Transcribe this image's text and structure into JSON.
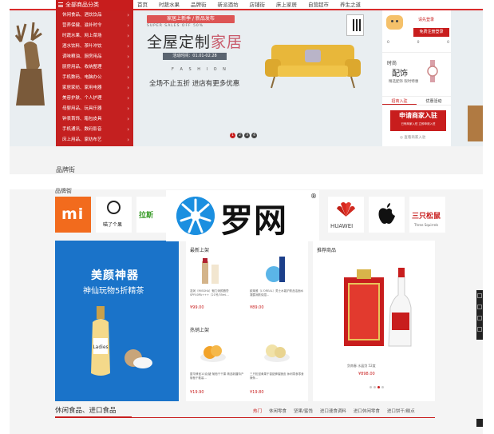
{
  "banner": {
    "catalog_label": "全部商品分类",
    "nav": [
      "首页",
      "时蔬水果",
      "品牌街",
      "新派酒坊",
      "店铺街",
      "床上家居",
      "自营超市",
      "养生之道"
    ],
    "categories": [
      "休闲食品、酒饮饮品",
      "营养保健、滋补时令",
      "时蔬水果、网上菜场",
      "酒水饮料、茶叶冲饮",
      "调味粮油、厨房用品",
      "厨房用品、收纳整理",
      "手机数码、电脑办公",
      "家居家纺、家用电器",
      "美容护肤、个人护理",
      "母婴用品、玩具乐器",
      "钟表首饰、箱包皮具",
      "手机通讯、数码影音",
      "床上用品、家纺布艺"
    ],
    "hero": {
      "badge": "家居上新季 / 新品发布",
      "sub": "SUPER SALES OFF 50%",
      "title_main": "全屋定制",
      "title_accent": "家居",
      "date": "活动时间：01.01-02.28",
      "fashion": "F A S H I O N",
      "promo": "全场不止五折  进店有更多优惠"
    },
    "slider_dots": [
      "1",
      "2",
      "3",
      "4"
    ],
    "user_panel": {
      "greeting": "请先登录",
      "login_button": "免费注册登录",
      "stats": [
        "0",
        "0",
        "0"
      ],
      "ad_line1": "时尚",
      "ad_line2": "配饰",
      "ad_line3": "精选配饰 限时特惠",
      "tabs": [
        "招商入驻",
        "优惠活动"
      ],
      "merchant_title": "申请商家入驻",
      "merchant_sub": "已有商家入驻 立即申请入驻",
      "bottom_link": "◎ 查看商家入驻"
    },
    "brand_street": "品牌街"
  },
  "lower": {
    "brand_label": "品牌街",
    "brands": {
      "mi": "mi",
      "nut": "喵了个果",
      "lasi": "拉斯",
      "huawei": "HUAWEI",
      "sanzhi": "三只松鼠",
      "sanzhi_sub": "Three Squirrels"
    },
    "watermark": {
      "text": "罗网",
      "reg": "®"
    },
    "promo": {
      "title": "美颜神器",
      "sub": "神仙玩物5折精茶",
      "bottle_label": "Ladies"
    },
    "new_arrivals": {
      "title": "最新上架",
      "items": [
        {
          "desc": "滋润（MISSHA）魅力润颜唇膏 SPF40PA+++（21号/35ml...",
          "price": "¥99.00"
        },
        {
          "desc": "欧莱雅（L'OREAL）男士水能护肤品洁面水凝露润肤保湿...",
          "price": "¥89.00"
        }
      ]
    },
    "hot_sale": {
      "title": "热销上架",
      "items": [
        {
          "desc": "屋华蜂宝10克/罐 葡萄干干果 精选新疆特产 葡萄干散装...",
          "price": "¥19.90"
        },
        {
          "desc": "三只松鼠黄果干香甜蜂蜜脆皮 休闲零食零食辣条...",
          "price": "¥19.80"
        }
      ]
    },
    "recommend": {
      "title": "推荐商品",
      "desc": "剑南春 水晶剑 52度",
      "price": "¥898.00",
      "dots": 4
    },
    "bottom": {
      "title": "休闲食品、进口食品",
      "tabs": [
        "热门",
        "休闲零食",
        "坚果/蜜饯",
        "进口速食调料",
        "进口休闲零食",
        "进口饼干/糕点"
      ]
    }
  },
  "colors": {
    "accent": "#c81d1d",
    "promo_blue": "#1a73c9",
    "mi_orange": "#f26b1d"
  }
}
